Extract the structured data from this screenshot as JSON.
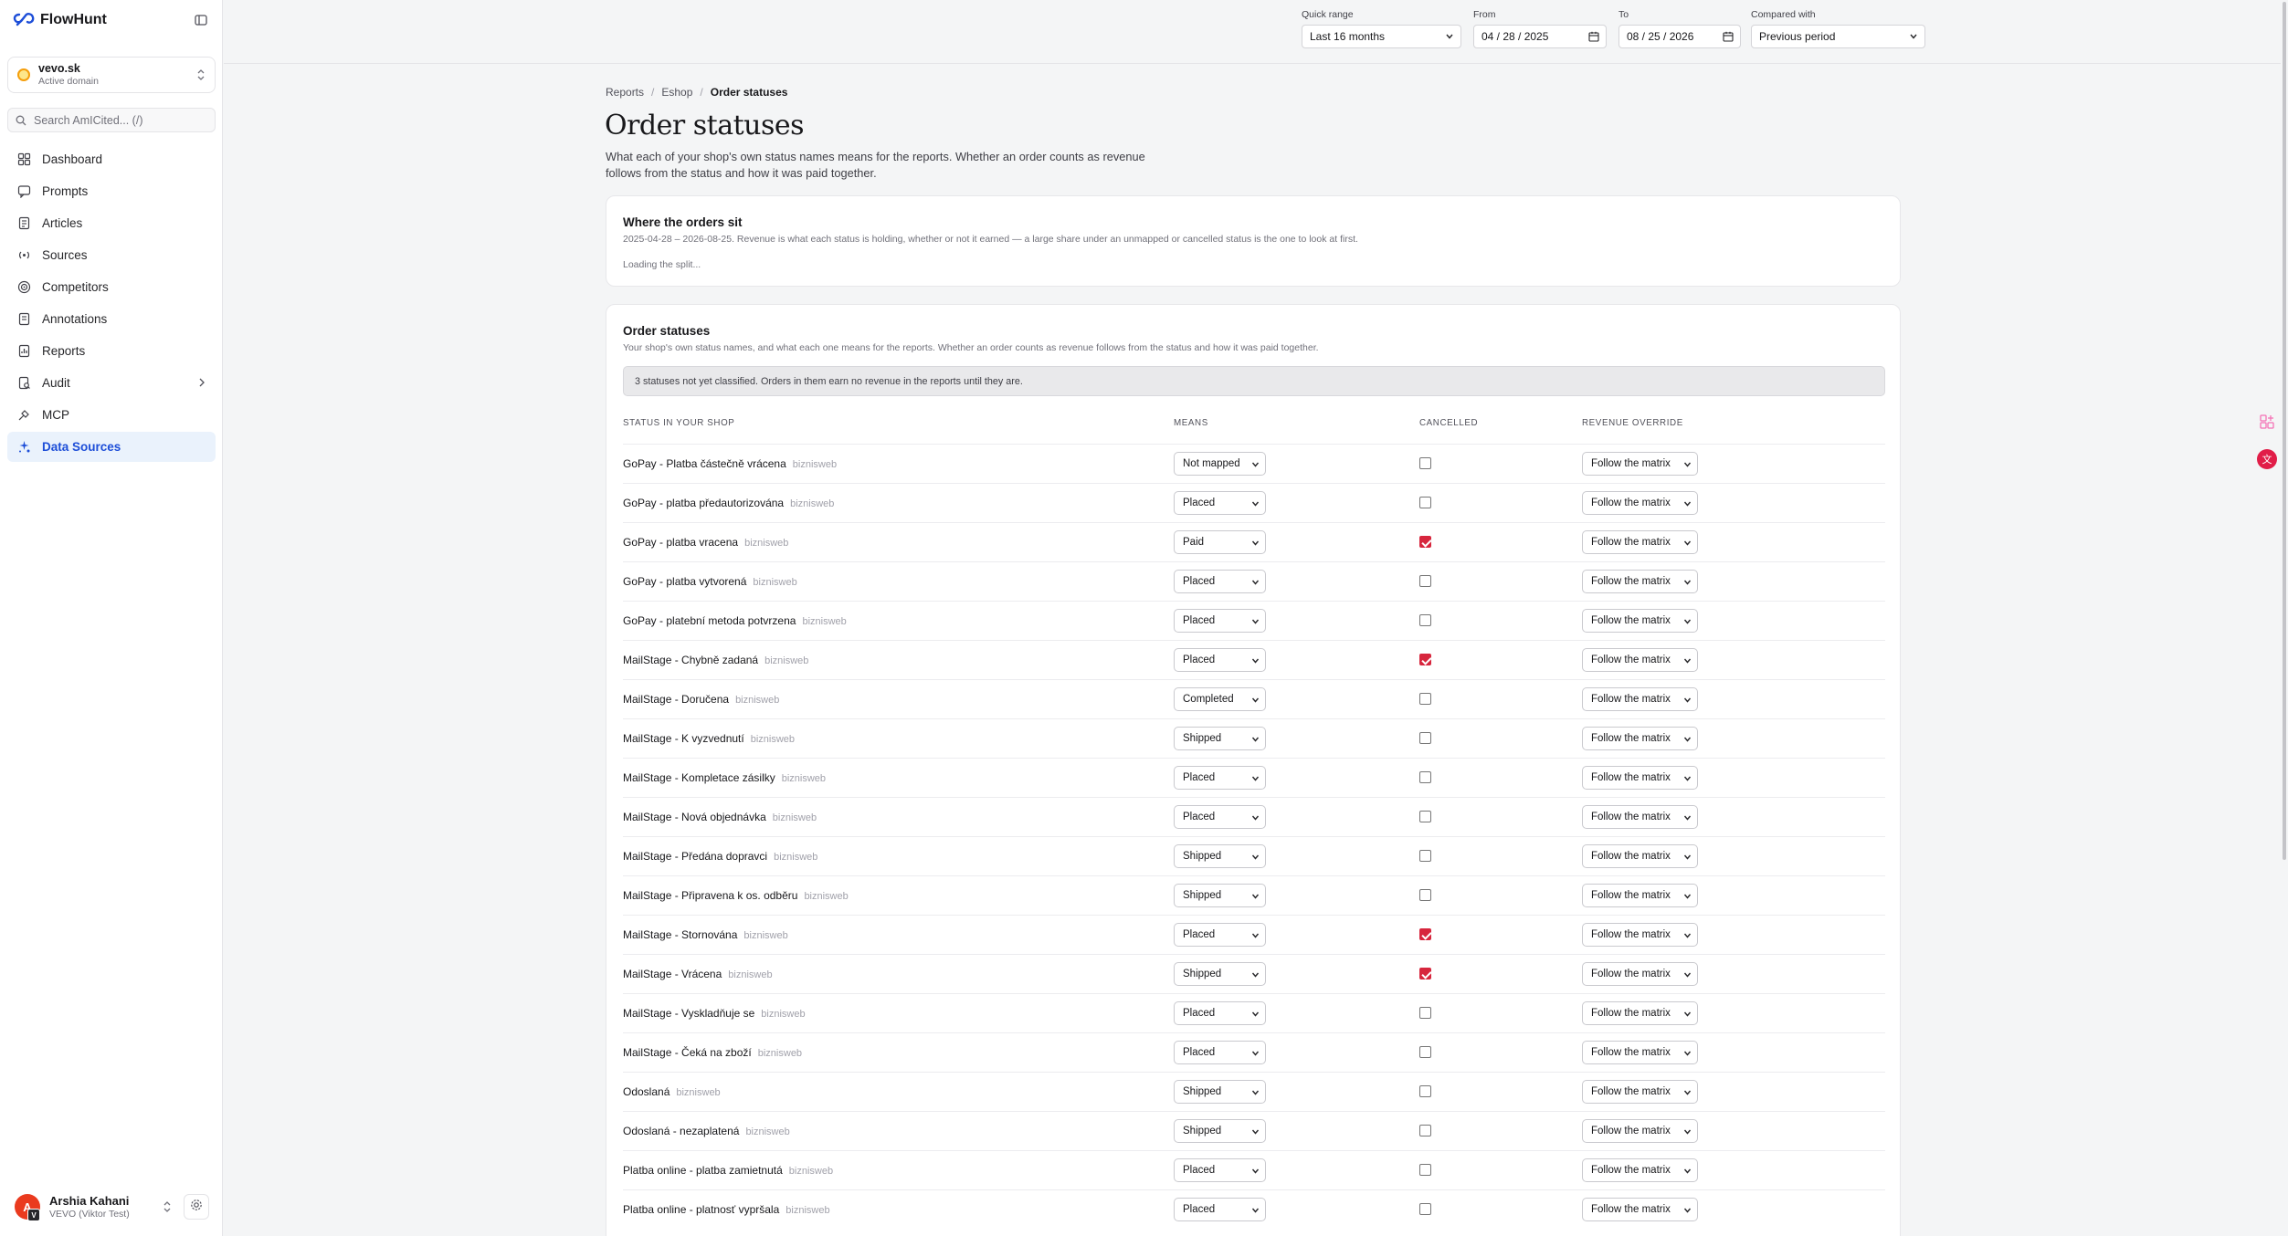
{
  "app": {
    "name": "FlowHunt"
  },
  "domain": {
    "name": "vevo.sk",
    "subtitle": "Active domain"
  },
  "search": {
    "placeholder": "Search AmICited... (/)"
  },
  "nav": {
    "items": [
      {
        "label": "Dashboard",
        "icon": "dashboard-icon"
      },
      {
        "label": "Prompts",
        "icon": "prompts-icon"
      },
      {
        "label": "Articles",
        "icon": "articles-icon"
      },
      {
        "label": "Sources",
        "icon": "sources-icon"
      },
      {
        "label": "Competitors",
        "icon": "competitors-icon"
      },
      {
        "label": "Annotations",
        "icon": "annotations-icon"
      },
      {
        "label": "Reports",
        "icon": "reports-icon"
      },
      {
        "label": "Audit",
        "icon": "audit-icon"
      },
      {
        "label": "MCP",
        "icon": "mcp-icon"
      },
      {
        "label": "Data Sources",
        "icon": "data-sources-icon",
        "active": true
      }
    ]
  },
  "user": {
    "name": "Arshia Kahani",
    "org": "VEVO (Viktor Test)",
    "initial": "A",
    "badge": "V"
  },
  "filters": {
    "quick_range": {
      "label": "Quick range",
      "value": "Last 16 months"
    },
    "from": {
      "label": "From",
      "value": "04 / 28 / 2025"
    },
    "to": {
      "label": "To",
      "value": "08 / 25 / 2026"
    },
    "compared": {
      "label": "Compared with",
      "value": "Previous period"
    }
  },
  "breadcrumb": {
    "items": [
      "Reports",
      "Eshop",
      "Order statuses"
    ]
  },
  "page": {
    "title": "Order statuses",
    "description": "What each of your shop's own status names means for the reports. Whether an order counts as revenue follows from the status and how it was paid together."
  },
  "where_card": {
    "title": "Where the orders sit",
    "subtitle": "2025-04-28 – 2026-08-25. Revenue is what each status is holding, whether or not it earned — a large share under an unmapped or cancelled status is the one to look at first.",
    "loading": "Loading the split..."
  },
  "orders_card": {
    "title": "Order statuses",
    "subtitle": "Your shop's own status names, and what each one means for the reports. Whether an order counts as revenue follows from the status and how it was paid together.",
    "banner": "3 statuses not yet classified. Orders in them earn no revenue in the reports until they are.",
    "columns": [
      "STATUS IN YOUR SHOP",
      "MEANS",
      "CANCELLED",
      "REVENUE OVERRIDE"
    ],
    "rows": [
      {
        "name": "GoPay - Platba částečně vrácena",
        "source": "biznisweb",
        "means": "Not mapped",
        "cancelled": false,
        "override": "Follow the matrix"
      },
      {
        "name": "GoPay - platba předautorizována",
        "source": "biznisweb",
        "means": "Placed",
        "cancelled": false,
        "override": "Follow the matrix"
      },
      {
        "name": "GoPay - platba vracena",
        "source": "biznisweb",
        "means": "Paid",
        "cancelled": true,
        "override": "Follow the matrix"
      },
      {
        "name": "GoPay - platba vytvorená",
        "source": "biznisweb",
        "means": "Placed",
        "cancelled": false,
        "override": "Follow the matrix"
      },
      {
        "name": "GoPay - platební metoda potvrzena",
        "source": "biznisweb",
        "means": "Placed",
        "cancelled": false,
        "override": "Follow the matrix"
      },
      {
        "name": "MailStage - Chybně zadaná",
        "source": "biznisweb",
        "means": "Placed",
        "cancelled": true,
        "override": "Follow the matrix"
      },
      {
        "name": "MailStage - Doručena",
        "source": "biznisweb",
        "means": "Completed",
        "cancelled": false,
        "override": "Follow the matrix"
      },
      {
        "name": "MailStage - K vyzvednutí",
        "source": "biznisweb",
        "means": "Shipped",
        "cancelled": false,
        "override": "Follow the matrix"
      },
      {
        "name": "MailStage - Kompletace zásilky",
        "source": "biznisweb",
        "means": "Placed",
        "cancelled": false,
        "override": "Follow the matrix"
      },
      {
        "name": "MailStage - Nová objednávka",
        "source": "biznisweb",
        "means": "Placed",
        "cancelled": false,
        "override": "Follow the matrix"
      },
      {
        "name": "MailStage - Předána dopravci",
        "source": "biznisweb",
        "means": "Shipped",
        "cancelled": false,
        "override": "Follow the matrix"
      },
      {
        "name": "MailStage - Připravena k os. odběru",
        "source": "biznisweb",
        "means": "Shipped",
        "cancelled": false,
        "override": "Follow the matrix"
      },
      {
        "name": "MailStage - Stornována",
        "source": "biznisweb",
        "means": "Placed",
        "cancelled": true,
        "override": "Follow the matrix"
      },
      {
        "name": "MailStage - Vrácena",
        "source": "biznisweb",
        "means": "Shipped",
        "cancelled": true,
        "override": "Follow the matrix"
      },
      {
        "name": "MailStage - Vyskladňuje se",
        "source": "biznisweb",
        "means": "Placed",
        "cancelled": false,
        "override": "Follow the matrix"
      },
      {
        "name": "MailStage - Čeká na zboží",
        "source": "biznisweb",
        "means": "Placed",
        "cancelled": false,
        "override": "Follow the matrix"
      },
      {
        "name": "Odoslaná",
        "source": "biznisweb",
        "means": "Shipped",
        "cancelled": false,
        "override": "Follow the matrix"
      },
      {
        "name": "Odoslaná - nezaplatená",
        "source": "biznisweb",
        "means": "Shipped",
        "cancelled": false,
        "override": "Follow the matrix"
      },
      {
        "name": "Platba online - platba zamietnutá",
        "source": "biznisweb",
        "means": "Placed",
        "cancelled": false,
        "override": "Follow the matrix"
      },
      {
        "name": "Platba online - platnosť vypršala",
        "source": "biznisweb",
        "means": "Placed",
        "cancelled": false,
        "override": "Follow the matrix"
      }
    ]
  },
  "colors": {
    "accent": "#1d4ed8",
    "active_bg": "#eaf2fc",
    "checkbox_on": "#d7263d",
    "avatar": "#ea3a1e"
  }
}
